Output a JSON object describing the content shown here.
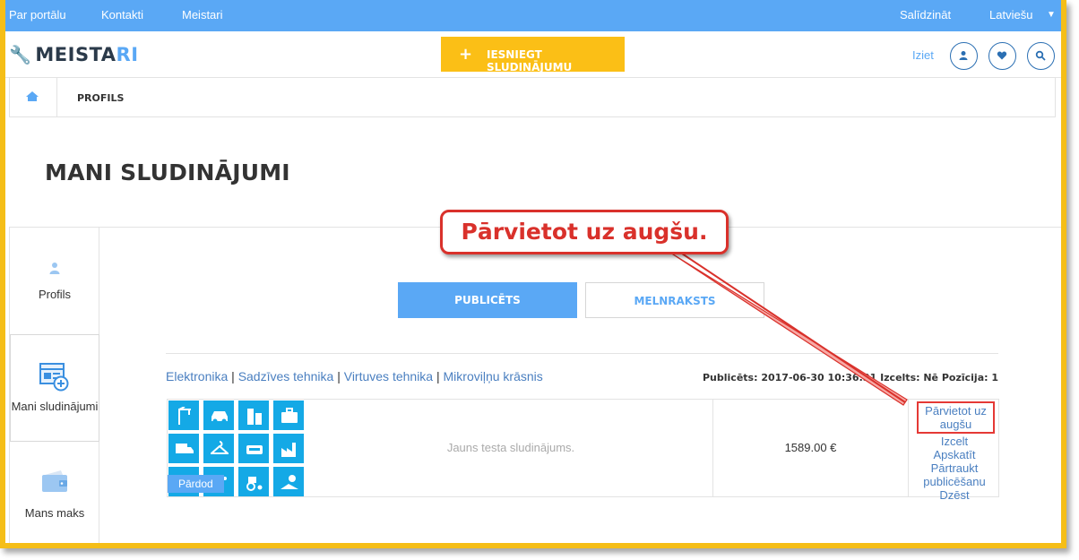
{
  "topbar": {
    "links": [
      "Par portālu",
      "Kontakti",
      "Meistari"
    ],
    "compare": "Salīdzināt",
    "language": "Latviešu"
  },
  "header": {
    "logo_main": "MEISTA",
    "logo_accent": "RI",
    "cta_label": "IESNIEGT SLUDINĀJUMU",
    "logout": "Iziet",
    "icons": [
      "user-icon",
      "heart-icon",
      "search-icon"
    ]
  },
  "breadcrumb": {
    "current": "PROFILS"
  },
  "page_title": "MANI SLUDINĀJUMI",
  "sidebar": {
    "items": [
      {
        "label": "Profils",
        "icon": "user-icon"
      },
      {
        "label": "Mani sludinājumi",
        "icon": "listings-add-icon"
      },
      {
        "label": "Mans maks",
        "icon": "wallet-icon"
      }
    ]
  },
  "tabs": {
    "published": "PUBLICĒTS",
    "draft": "MELNRAKSTS"
  },
  "listing": {
    "categories": [
      "Elektronika",
      "Sadzīves tehnika",
      "Virtuves tehnika",
      "Mikroviļņu krāsnis"
    ],
    "meta": "Publicēts: 2017-06-30 10:36:31  Izcelts: Nē  Pozīcija: 1",
    "badge": "Pārdod",
    "description": "Jauns testa sludinājums.",
    "price": "1589.00 €",
    "actions": {
      "move_up": "Pārvietot uz augšu",
      "highlight": "Izcelt",
      "view": "Apskatīt",
      "stop": "Pārtraukt publicēšanu",
      "delete": "Dzēst"
    }
  },
  "callout": "Pārvietot uz augšu.",
  "colors": {
    "accent": "#5aa8f5",
    "cta": "#fbbf16",
    "frame": "#f5be17",
    "callout": "#d9312b",
    "tile": "#14a9e6"
  }
}
